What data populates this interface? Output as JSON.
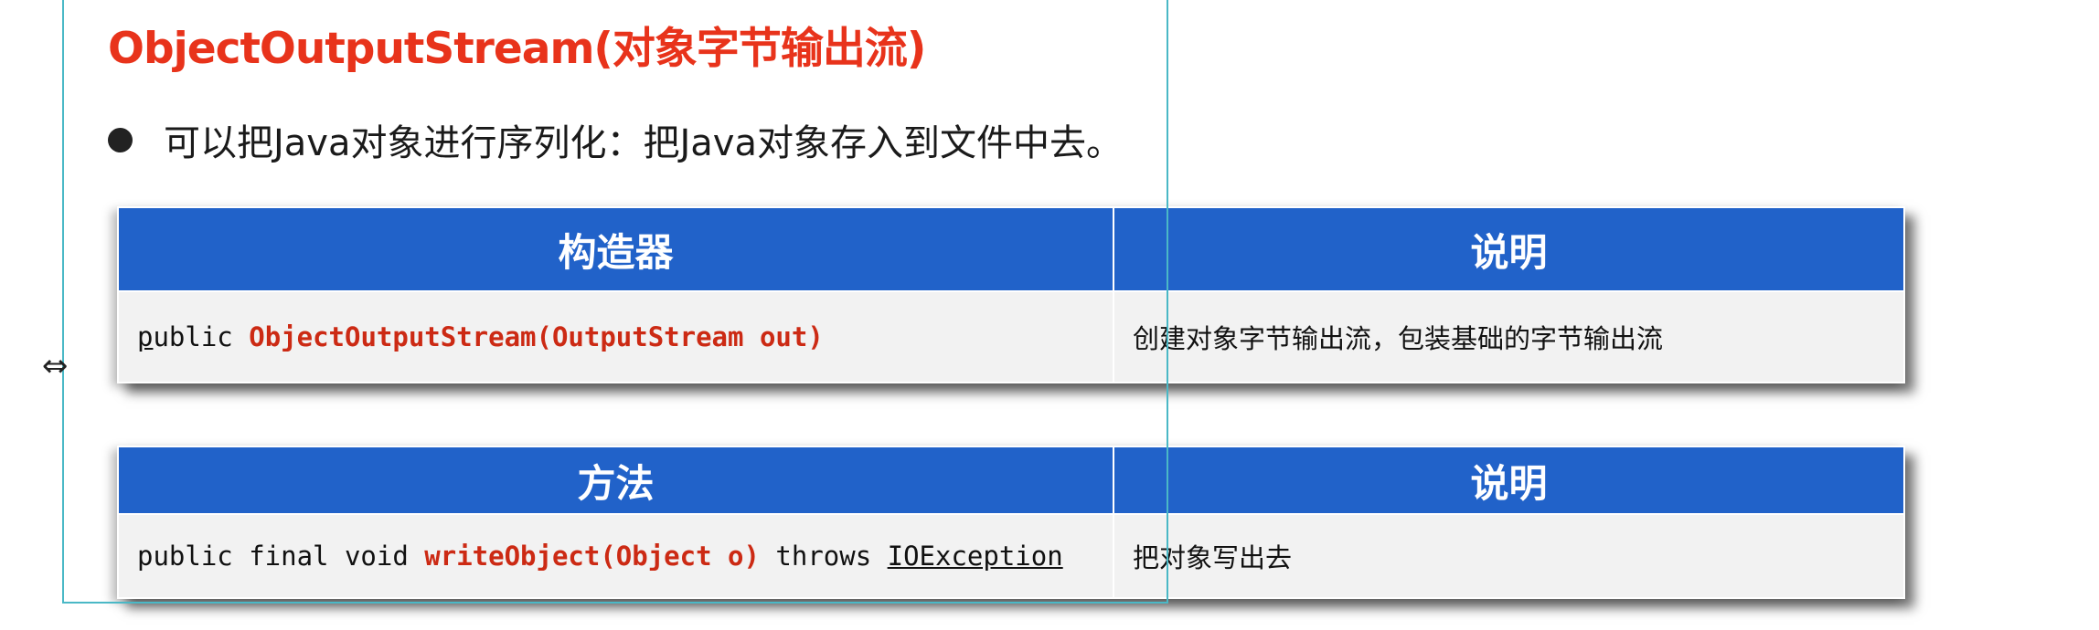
{
  "title": "ObjectOutputStream(对象字节输出流)",
  "bullet": "可以把Java对象进行序列化：把Java对象存入到文件中去。",
  "table1": {
    "header_left": "构造器",
    "header_right": "说明",
    "row": {
      "code_prefix_u": "p",
      "code_prefix_rest": "ublic ",
      "code_red": "ObjectOutputStream(OutputStream out)",
      "desc": "创建对象字节输出流，包装基础的字节输出流"
    }
  },
  "table2": {
    "header_left": "方法",
    "header_right": "说明",
    "row": {
      "code_prefix": "public final void ",
      "code_red": "writeObject(Object o)",
      "code_mid": " throws ",
      "code_underlined": "IOException",
      "desc": "把对象写出去"
    }
  },
  "colors": {
    "title": "#e8331b",
    "header_bg": "#2162c9",
    "code_red": "#cc2a14",
    "overlay_border": "#4ab8c6"
  },
  "icons": [
    "resize-horizontal-cursor-icon",
    "bullet-dot-icon"
  ]
}
